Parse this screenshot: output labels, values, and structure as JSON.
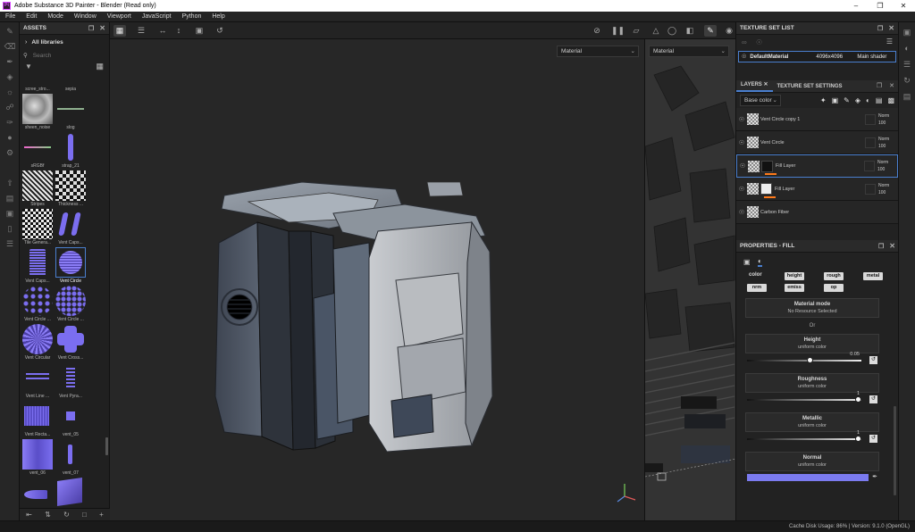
{
  "window": {
    "title": "Adobe Substance 3D Painter - Blender (Read only)",
    "app_badge": "Pt"
  },
  "menu": [
    "File",
    "Edit",
    "Mode",
    "Window",
    "Viewport",
    "JavaScript",
    "Python",
    "Help"
  ],
  "assets": {
    "title": "ASSETS",
    "library": "All libraries",
    "search_placeholder": "Search",
    "items": [
      {
        "label": "scree_stro..."
      },
      {
        "label": "sepia"
      },
      {
        "label": "sheen_noise"
      },
      {
        "label": "slog"
      },
      {
        "label": "sRGBf"
      },
      {
        "label": "strap_21"
      },
      {
        "label": "Stripes"
      },
      {
        "label": "Thickness ..."
      },
      {
        "label": "Tile Genera..."
      },
      {
        "label": "Vent Caps..."
      },
      {
        "label": "Vent Caps..."
      },
      {
        "label": "Vent Circle"
      },
      {
        "label": "Vent Circle ..."
      },
      {
        "label": "Vent Circle ..."
      },
      {
        "label": "Vent Circular"
      },
      {
        "label": "Vent Cross..."
      },
      {
        "label": "Vent Line ..."
      },
      {
        "label": "Vent Pyra..."
      },
      {
        "label": "Vent Recta..."
      },
      {
        "label": "vent_05"
      },
      {
        "label": "vent_06"
      },
      {
        "label": "vent_07"
      },
      {
        "label": ""
      },
      {
        "label": ""
      }
    ]
  },
  "viewport": {
    "mode_3d": "Material",
    "mode_2d": "Material"
  },
  "texture_set_list": {
    "title": "TEXTURE SET LIST",
    "name": "DefaultMaterial",
    "size": "4096x4096",
    "shader": "Main shader"
  },
  "layers": {
    "tab_layers": "LAYERS",
    "tab_settings": "TEXTURE SET SETTINGS",
    "channel": "Base color",
    "items": [
      {
        "name": "Vent Circle copy 1",
        "blend": "Norm",
        "opacity": "100"
      },
      {
        "name": "Vent Circle",
        "blend": "Norm",
        "opacity": "100"
      },
      {
        "name": "Fill Layer",
        "blend": "Norm",
        "opacity": "100"
      },
      {
        "name": "Fill Layer",
        "blend": "Norm",
        "opacity": "100"
      },
      {
        "name": "Carbon Fiber",
        "blend": "Norm",
        "opacity": "100"
      }
    ]
  },
  "properties": {
    "title": "PROPERTIES - FILL",
    "channels": [
      "color",
      "height",
      "rough",
      "metal",
      "nrm",
      "emiss",
      "op"
    ],
    "material_mode": {
      "title": "Material mode",
      "value": "No Resource Selected"
    },
    "or_label": "Or",
    "height": {
      "title": "Height",
      "sub": "uniform color",
      "value": "0.05",
      "level": 0.05
    },
    "roughness": {
      "title": "Roughness",
      "sub": "uniform color",
      "value": "1",
      "level": 1
    },
    "metallic": {
      "title": "Metallic",
      "sub": "uniform color",
      "value": "1",
      "level": 1
    },
    "normal": {
      "title": "Normal",
      "sub": "uniform color",
      "color": "#7b7bf0"
    }
  },
  "status": {
    "text": "Cache Disk Usage:   86% | Version: 9.1.0 (OpenGL)"
  }
}
